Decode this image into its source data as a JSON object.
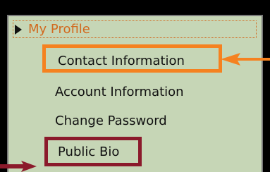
{
  "menu": {
    "header_label": "My Profile",
    "header_icon": "triangle-right-icon",
    "items": [
      {
        "label": "Contact Information"
      },
      {
        "label": "Account Information"
      },
      {
        "label": "Change Password"
      },
      {
        "label": "Public Bio"
      }
    ]
  },
  "colors": {
    "panel_background": "#c6d6b6",
    "header_text": "#d2691e",
    "highlight_orange": "#f58220",
    "highlight_red": "#8b1a2b",
    "frame": "#000000"
  }
}
